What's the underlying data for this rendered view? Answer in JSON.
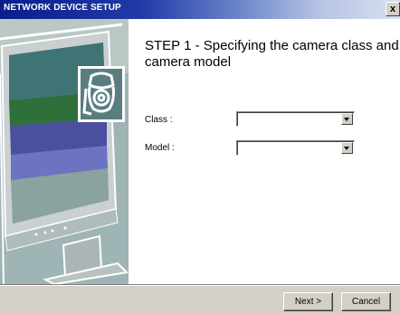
{
  "window": {
    "title": "NETWORK DEVICE SETUP",
    "close_label": "x"
  },
  "main": {
    "step_title": "STEP 1 -  Specifying the camera class and camera model"
  },
  "form": {
    "class_label": "Class :",
    "class_value": "",
    "model_label": "Model :",
    "model_value": ""
  },
  "buttons": {
    "next_label": "Next >",
    "cancel_label": "Cancel"
  },
  "colors": {
    "titlebar_start": "#0a1f8a",
    "titlebar_end": "#d7dfef",
    "dialog_face": "#d4d0c8",
    "panel_teal": "#8aa7a5"
  },
  "icons": {
    "camera": "camera-icon"
  }
}
